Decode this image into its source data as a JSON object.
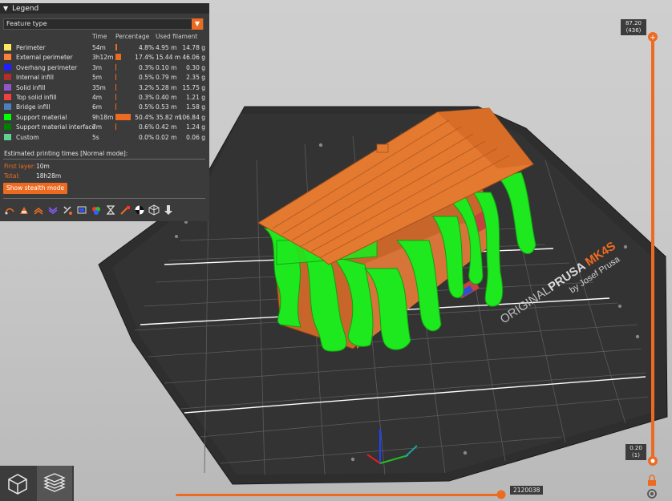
{
  "legend": {
    "title": "Legend",
    "view_type": "Feature type",
    "columns": {
      "time": "Time",
      "percentage": "Percentage",
      "used_filament": "Used filament"
    },
    "features": [
      {
        "name": "Perimeter",
        "color": "#FFE65F",
        "time": "54m",
        "percent": "4.8%",
        "percent_value": 4.8,
        "length": "4.95 m",
        "weight": "14.78 g"
      },
      {
        "name": "External perimeter",
        "color": "#FF7E38",
        "time": "3h12m",
        "percent": "17.4%",
        "percent_value": 17.4,
        "length": "15.44 m",
        "weight": "46.06 g"
      },
      {
        "name": "Overhang perimeter",
        "color": "#1F1FFF",
        "time": "3m",
        "percent": "0.3%",
        "percent_value": 0.3,
        "length": "0.10 m",
        "weight": "0.30 g"
      },
      {
        "name": "Internal infill",
        "color": "#B03029",
        "time": "5m",
        "percent": "0.5%",
        "percent_value": 0.5,
        "length": "0.79 m",
        "weight": "2.35 g"
      },
      {
        "name": "Solid infill",
        "color": "#9654CC",
        "time": "35m",
        "percent": "3.2%",
        "percent_value": 3.2,
        "length": "5.28 m",
        "weight": "15.75 g"
      },
      {
        "name": "Top solid infill",
        "color": "#F04040",
        "time": "4m",
        "percent": "0.3%",
        "percent_value": 0.3,
        "length": "0.40 m",
        "weight": "1.21 g"
      },
      {
        "name": "Bridge infill",
        "color": "#4D80BA",
        "time": "6m",
        "percent": "0.5%",
        "percent_value": 0.5,
        "length": "0.53 m",
        "weight": "1.58 g"
      },
      {
        "name": "Support material",
        "color": "#00FF00",
        "time": "9h18m",
        "percent": "50.4%",
        "percent_value": 50.4,
        "length": "35.82 m",
        "weight": "106.84 g"
      },
      {
        "name": "Support material interface",
        "color": "#008000",
        "time": "7m",
        "percent": "0.6%",
        "percent_value": 0.6,
        "length": "0.42 m",
        "weight": "1.24 g"
      },
      {
        "name": "Custom",
        "color": "#5ED194",
        "time": "5s",
        "percent": "0.0%",
        "percent_value": 0.0,
        "length": "0.02 m",
        "weight": "0.06 g"
      }
    ],
    "estimated_label": "Estimated printing times [Normal mode]:",
    "first_layer_label": "First layer:",
    "first_layer_value": "10m",
    "total_label": "Total:",
    "total_value": "18h28m",
    "stealth_button": "Show stealth mode",
    "toolbar_icons": [
      "travel-icon",
      "wipe-icon",
      "retractions-icon",
      "deretractions-icon",
      "seams-icon",
      "tool-changes-icon",
      "color-changes-icon",
      "pause-icon",
      "custom-gcode-icon",
      "center-of-gravity-icon",
      "shells-icon",
      "tool-marker-icon"
    ]
  },
  "bed": {
    "brand": "ORIGINAL",
    "brand_bold": "PRUSA",
    "model": "MK4S",
    "byline": "by Josef Prusa"
  },
  "vertical_slider": {
    "top_height": "87.20",
    "top_layer": "(436)",
    "bottom_height": "0.20",
    "bottom_layer": "(1)"
  },
  "horizontal_slider": {
    "value": "2120038"
  },
  "view_buttons": {
    "left": "3d-view-icon",
    "right": "layers-view-icon"
  },
  "colors": {
    "accent": "#ED6B21",
    "panel": "#3B3B3B",
    "bed": "#2E2E2E"
  }
}
